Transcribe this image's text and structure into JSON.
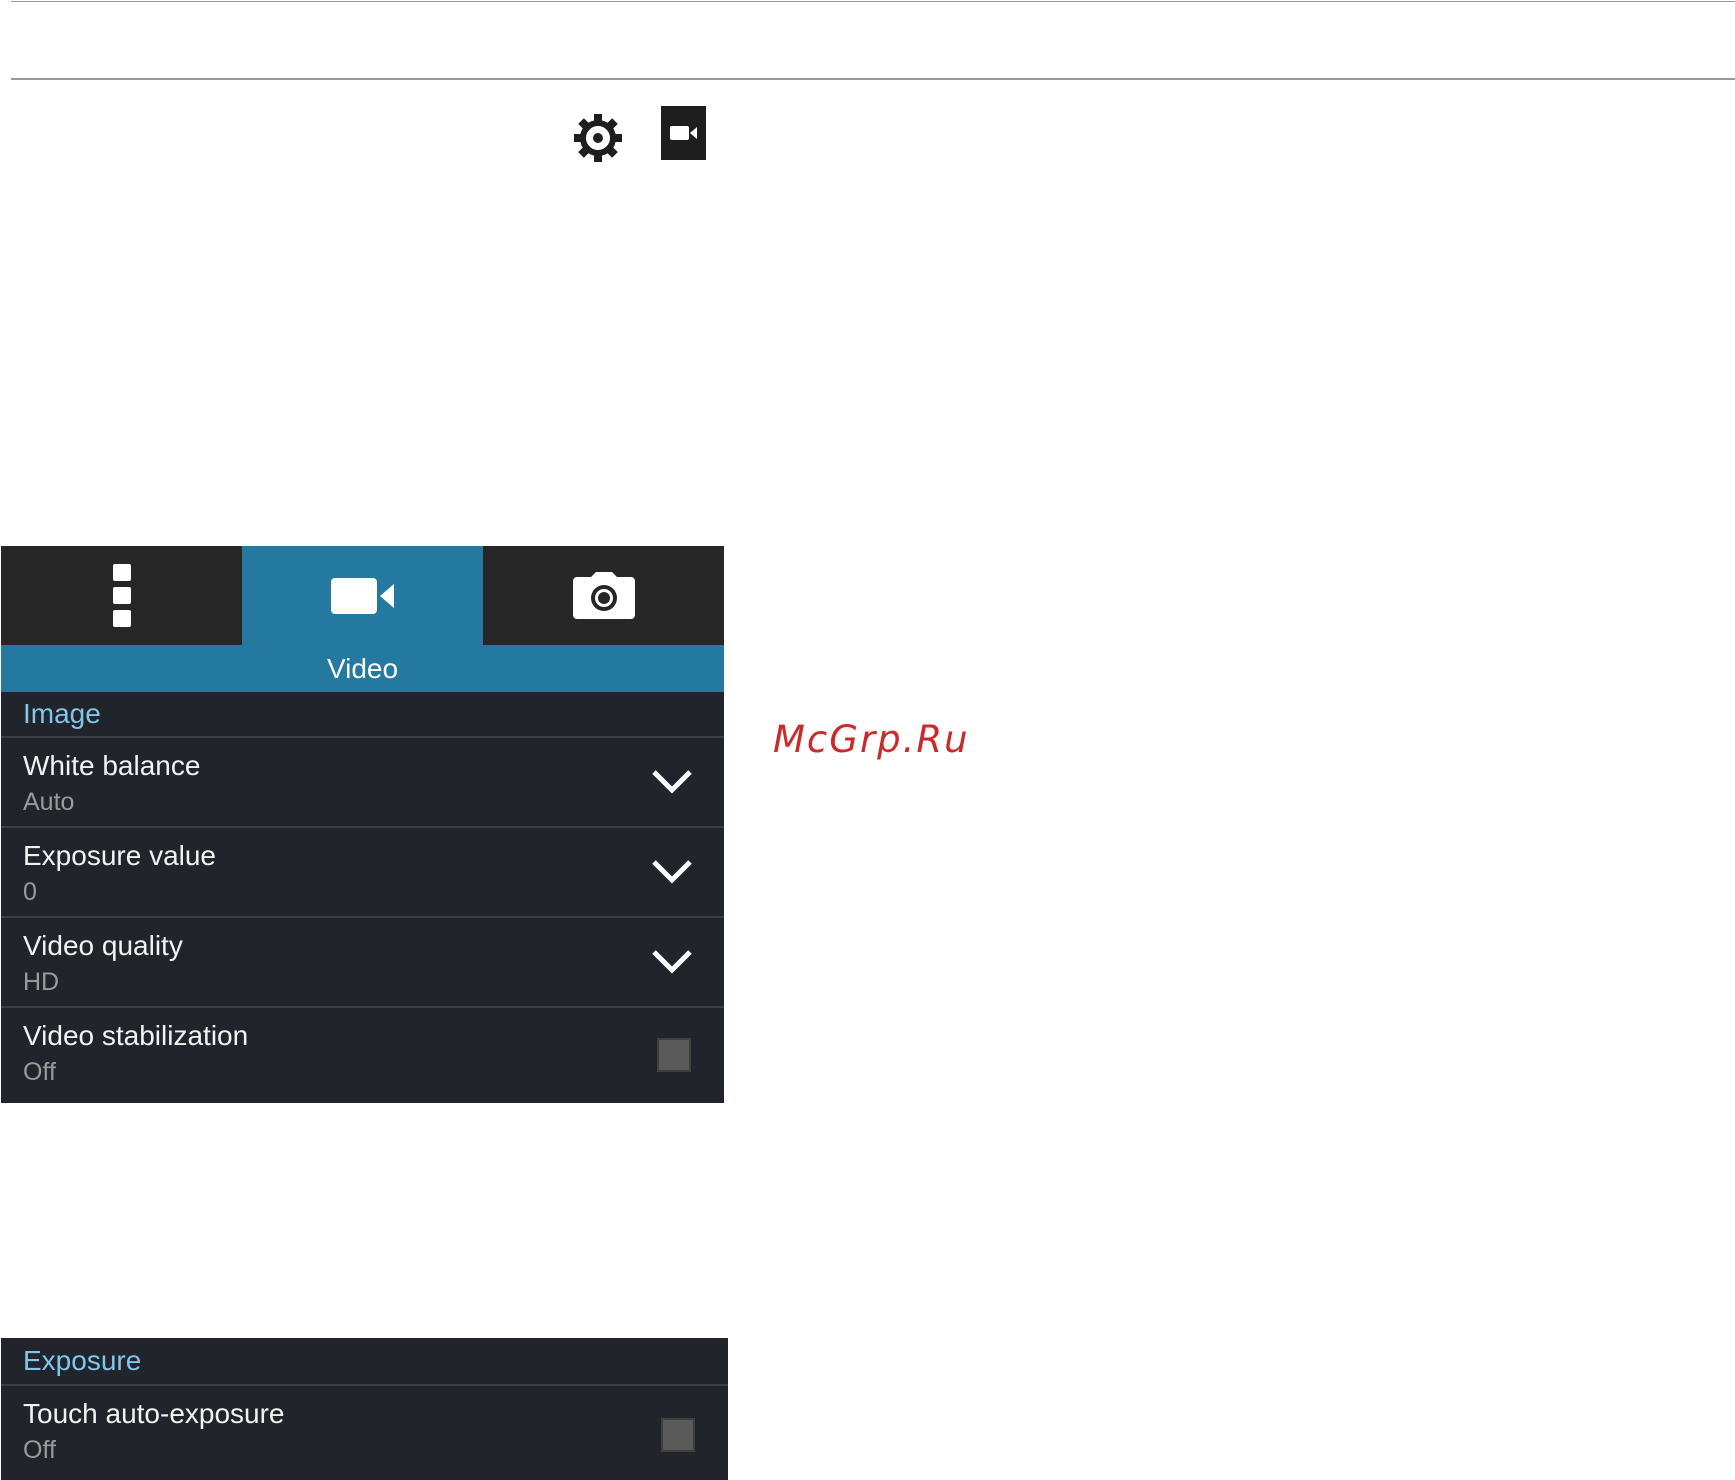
{
  "icons": {
    "inline_settings": "gear-icon",
    "inline_video": "video-camera-icon",
    "more": "vertical-dots-icon",
    "video_tab": "video-camera-icon",
    "photo_tab": "camera-icon",
    "dropdown": "chevron-down-icon"
  },
  "watermark": "McGrp.Ru",
  "panel": {
    "mode_title": "Video",
    "section": "Image",
    "rows": [
      {
        "label": "White balance",
        "value": "Auto",
        "control": "dropdown"
      },
      {
        "label": "Exposure value",
        "value": "0",
        "control": "dropdown"
      },
      {
        "label": "Video quality",
        "value": "HD",
        "control": "dropdown"
      },
      {
        "label": "Video stabilization",
        "value": "Off",
        "control": "checkbox",
        "checked": false
      }
    ]
  },
  "exposure_panel": {
    "section": "Exposure",
    "rows": [
      {
        "label": "Touch auto-exposure",
        "value": "Off",
        "control": "checkbox",
        "checked": false
      }
    ]
  },
  "colors": {
    "accent": "#2379a0",
    "section_text": "#7fc6ea",
    "panel_bg": "#21242a",
    "tabbar_bg": "#272727",
    "watermark": "#cc2a2a"
  }
}
